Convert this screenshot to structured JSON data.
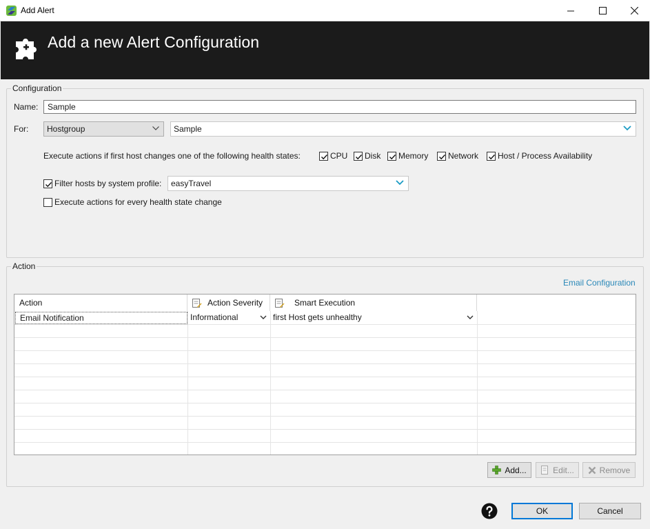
{
  "window": {
    "title": "Add Alert",
    "controls": {
      "minimize": "—",
      "maximize": "☐",
      "close": "✕"
    }
  },
  "banner": {
    "title": "Add a new Alert Configuration",
    "icon": "puzzle-plus-icon"
  },
  "configuration": {
    "group_label": "Configuration",
    "name_label": "Name:",
    "name_value": "Sample",
    "for_label": "For:",
    "for_type": "Hostgroup",
    "for_value": "Sample",
    "health_states_prompt": "Execute actions if first host changes one of the following health states:",
    "health_states": [
      {
        "label": "CPU",
        "checked": true
      },
      {
        "label": "Disk",
        "checked": true
      },
      {
        "label": "Memory",
        "checked": true
      },
      {
        "label": "Network",
        "checked": true
      },
      {
        "label": "Host / Process Availability",
        "checked": true
      }
    ],
    "filter_label": "Filter hosts by system profile:",
    "filter_checked": true,
    "system_profile": "easyTravel",
    "every_change_label": "Execute actions for every health state change",
    "every_change_checked": false
  },
  "action": {
    "group_label": "Action",
    "email_config_link": "Email Configuration",
    "columns": [
      "Action",
      "Action Severity",
      "Smart Execution"
    ],
    "rows": [
      {
        "action": "Email Notification",
        "severity": "Informational",
        "smart_execution": "first Host gets unhealthy"
      }
    ],
    "add_label": "Add...",
    "edit_label": "Edit...",
    "remove_label": "Remove"
  },
  "footer": {
    "ok_label": "OK",
    "cancel_label": "Cancel",
    "help_icon": "question-icon"
  },
  "colors": {
    "banner_bg": "#1b1b1b",
    "link": "#2a88b8",
    "chevron": "#1a9bc4",
    "focus": "#0078d7"
  }
}
